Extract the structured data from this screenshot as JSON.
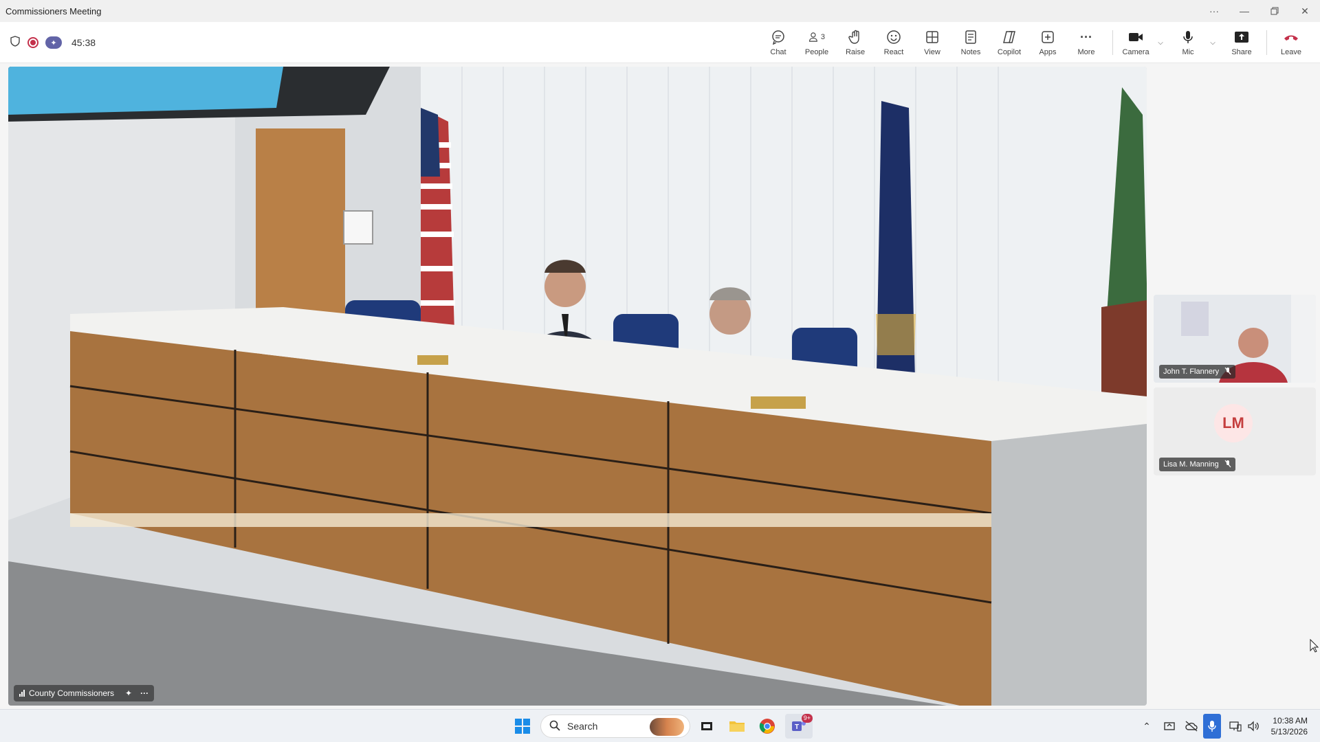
{
  "window": {
    "title": "Commissioners Meeting"
  },
  "toolbar": {
    "timer": "45:38",
    "people_count": "3",
    "buttons": {
      "chat": "Chat",
      "people": "People",
      "raise": "Raise",
      "react": "React",
      "view": "View",
      "notes": "Notes",
      "copilot": "Copilot",
      "apps": "Apps",
      "more": "More",
      "camera": "Camera",
      "mic": "Mic",
      "share": "Share",
      "leave": "Leave"
    }
  },
  "stage": {
    "caption": "County Commissioners"
  },
  "participants": [
    {
      "name": "John T. Flannery",
      "muted": true
    },
    {
      "name": "Lisa M. Manning",
      "initials": "LM",
      "muted": true
    }
  ],
  "taskbar": {
    "search_placeholder": "Search",
    "teams_badge": "9+",
    "time": "10:38 AM",
    "date": "5/13/2026"
  },
  "colors": {
    "leave": "#c4314b",
    "accent": "#6264a7",
    "taskbar_mic": "#2f6fd6"
  }
}
